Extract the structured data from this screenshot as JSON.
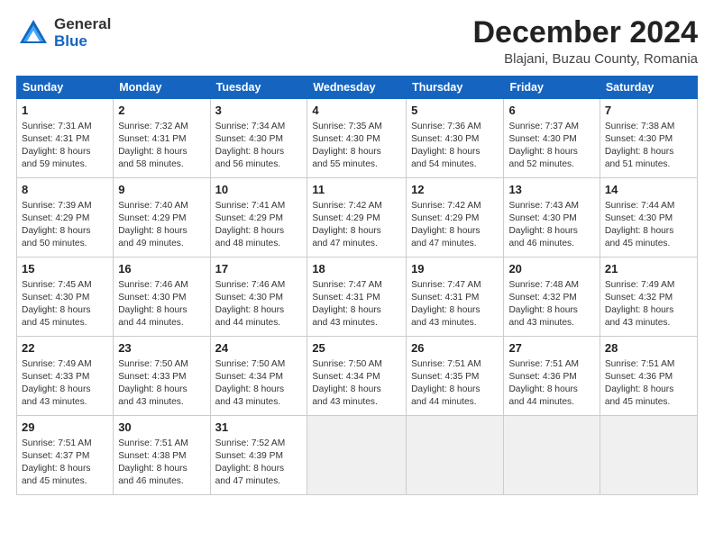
{
  "header": {
    "logo_general": "General",
    "logo_blue": "Blue",
    "month_title": "December 2024",
    "location": "Blajani, Buzau County, Romania"
  },
  "weekdays": [
    "Sunday",
    "Monday",
    "Tuesday",
    "Wednesday",
    "Thursday",
    "Friday",
    "Saturday"
  ],
  "weeks": [
    [
      {
        "day": "1",
        "info": "Sunrise: 7:31 AM\nSunset: 4:31 PM\nDaylight: 8 hours\nand 59 minutes."
      },
      {
        "day": "2",
        "info": "Sunrise: 7:32 AM\nSunset: 4:31 PM\nDaylight: 8 hours\nand 58 minutes."
      },
      {
        "day": "3",
        "info": "Sunrise: 7:34 AM\nSunset: 4:30 PM\nDaylight: 8 hours\nand 56 minutes."
      },
      {
        "day": "4",
        "info": "Sunrise: 7:35 AM\nSunset: 4:30 PM\nDaylight: 8 hours\nand 55 minutes."
      },
      {
        "day": "5",
        "info": "Sunrise: 7:36 AM\nSunset: 4:30 PM\nDaylight: 8 hours\nand 54 minutes."
      },
      {
        "day": "6",
        "info": "Sunrise: 7:37 AM\nSunset: 4:30 PM\nDaylight: 8 hours\nand 52 minutes."
      },
      {
        "day": "7",
        "info": "Sunrise: 7:38 AM\nSunset: 4:30 PM\nDaylight: 8 hours\nand 51 minutes."
      }
    ],
    [
      {
        "day": "8",
        "info": "Sunrise: 7:39 AM\nSunset: 4:29 PM\nDaylight: 8 hours\nand 50 minutes."
      },
      {
        "day": "9",
        "info": "Sunrise: 7:40 AM\nSunset: 4:29 PM\nDaylight: 8 hours\nand 49 minutes."
      },
      {
        "day": "10",
        "info": "Sunrise: 7:41 AM\nSunset: 4:29 PM\nDaylight: 8 hours\nand 48 minutes."
      },
      {
        "day": "11",
        "info": "Sunrise: 7:42 AM\nSunset: 4:29 PM\nDaylight: 8 hours\nand 47 minutes."
      },
      {
        "day": "12",
        "info": "Sunrise: 7:42 AM\nSunset: 4:29 PM\nDaylight: 8 hours\nand 47 minutes."
      },
      {
        "day": "13",
        "info": "Sunrise: 7:43 AM\nSunset: 4:30 PM\nDaylight: 8 hours\nand 46 minutes."
      },
      {
        "day": "14",
        "info": "Sunrise: 7:44 AM\nSunset: 4:30 PM\nDaylight: 8 hours\nand 45 minutes."
      }
    ],
    [
      {
        "day": "15",
        "info": "Sunrise: 7:45 AM\nSunset: 4:30 PM\nDaylight: 8 hours\nand 45 minutes."
      },
      {
        "day": "16",
        "info": "Sunrise: 7:46 AM\nSunset: 4:30 PM\nDaylight: 8 hours\nand 44 minutes."
      },
      {
        "day": "17",
        "info": "Sunrise: 7:46 AM\nSunset: 4:30 PM\nDaylight: 8 hours\nand 44 minutes."
      },
      {
        "day": "18",
        "info": "Sunrise: 7:47 AM\nSunset: 4:31 PM\nDaylight: 8 hours\nand 43 minutes."
      },
      {
        "day": "19",
        "info": "Sunrise: 7:47 AM\nSunset: 4:31 PM\nDaylight: 8 hours\nand 43 minutes."
      },
      {
        "day": "20",
        "info": "Sunrise: 7:48 AM\nSunset: 4:32 PM\nDaylight: 8 hours\nand 43 minutes."
      },
      {
        "day": "21",
        "info": "Sunrise: 7:49 AM\nSunset: 4:32 PM\nDaylight: 8 hours\nand 43 minutes."
      }
    ],
    [
      {
        "day": "22",
        "info": "Sunrise: 7:49 AM\nSunset: 4:33 PM\nDaylight: 8 hours\nand 43 minutes."
      },
      {
        "day": "23",
        "info": "Sunrise: 7:50 AM\nSunset: 4:33 PM\nDaylight: 8 hours\nand 43 minutes."
      },
      {
        "day": "24",
        "info": "Sunrise: 7:50 AM\nSunset: 4:34 PM\nDaylight: 8 hours\nand 43 minutes."
      },
      {
        "day": "25",
        "info": "Sunrise: 7:50 AM\nSunset: 4:34 PM\nDaylight: 8 hours\nand 43 minutes."
      },
      {
        "day": "26",
        "info": "Sunrise: 7:51 AM\nSunset: 4:35 PM\nDaylight: 8 hours\nand 44 minutes."
      },
      {
        "day": "27",
        "info": "Sunrise: 7:51 AM\nSunset: 4:36 PM\nDaylight: 8 hours\nand 44 minutes."
      },
      {
        "day": "28",
        "info": "Sunrise: 7:51 AM\nSunset: 4:36 PM\nDaylight: 8 hours\nand 45 minutes."
      }
    ],
    [
      {
        "day": "29",
        "info": "Sunrise: 7:51 AM\nSunset: 4:37 PM\nDaylight: 8 hours\nand 45 minutes."
      },
      {
        "day": "30",
        "info": "Sunrise: 7:51 AM\nSunset: 4:38 PM\nDaylight: 8 hours\nand 46 minutes."
      },
      {
        "day": "31",
        "info": "Sunrise: 7:52 AM\nSunset: 4:39 PM\nDaylight: 8 hours\nand 47 minutes."
      },
      {
        "day": "",
        "info": ""
      },
      {
        "day": "",
        "info": ""
      },
      {
        "day": "",
        "info": ""
      },
      {
        "day": "",
        "info": ""
      }
    ]
  ]
}
